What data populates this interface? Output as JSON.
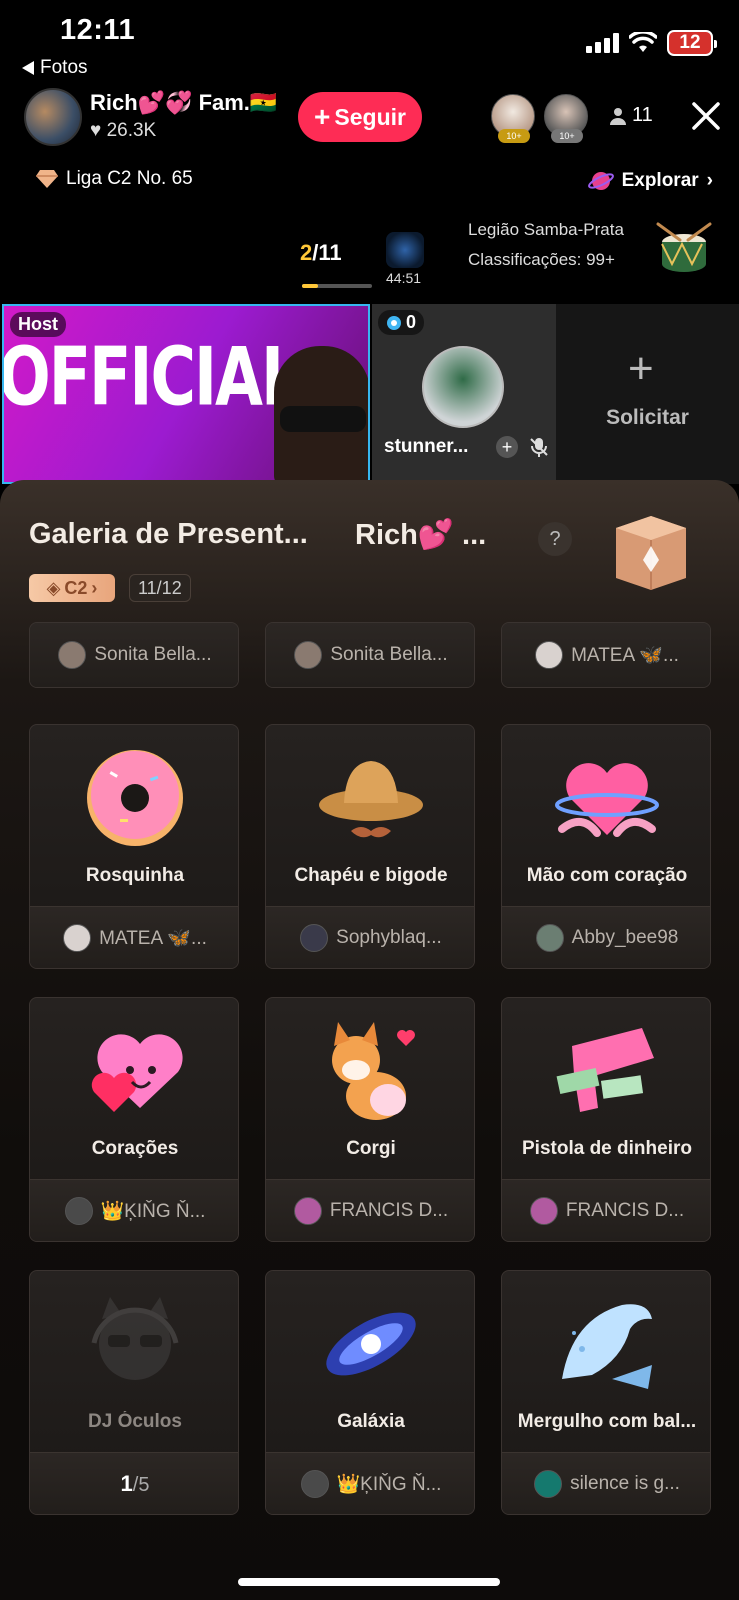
{
  "status": {
    "time": "12:11",
    "battery": "12",
    "back_label": "Fotos"
  },
  "header": {
    "host_name": "Rich💕💞 Fam.🇬🇭",
    "likes": "26.3K",
    "follow_label": "Seguir",
    "viewer_badges": [
      "10+",
      "10+"
    ],
    "viewer_count": "11"
  },
  "league": {
    "label": "Liga C2 No. 65",
    "explore_label": "Explorar"
  },
  "ranking": {
    "current": "2",
    "total": "/11",
    "timer": "44:51",
    "legion_title": "Legião Samba-Prata",
    "legion_rank": "Classificações: 99+"
  },
  "video": {
    "host_tag": "Host",
    "banner_text": "OFFICIAL",
    "guest_count": "0",
    "guest_name": "stunner...",
    "request_label": "Solicitar"
  },
  "gallery": {
    "title": "Galeria de Present...",
    "owner": "Rich💕 ...",
    "help": "?",
    "league_badge": "C2",
    "progress": "11/12",
    "partial_row": [
      {
        "who": "Sonita Bella..."
      },
      {
        "who": "Sonita Bella..."
      },
      {
        "who": "MATEA 🦋..."
      }
    ],
    "gifts": [
      {
        "name": "Rosquinha",
        "who": "MATEA 🦋..."
      },
      {
        "name": "Chapéu e bigode",
        "who": "Sophyblaq..."
      },
      {
        "name": "Mão com coração",
        "who": "Abby_bee98"
      },
      {
        "name": "Corações",
        "who": "👑ĶIŇG Ň..."
      },
      {
        "name": "Corgi",
        "who": "FRANCIS D..."
      },
      {
        "name": "Pistola de dinheiro",
        "who": "FRANCIS D..."
      },
      {
        "name": "DJ Óculos",
        "page_current": "1",
        "page_total": "/5"
      },
      {
        "name": "Galáxia",
        "who": "👑ĶIŇG Ň..."
      },
      {
        "name": "Mergulho com bal...",
        "who": "silence is g..."
      }
    ]
  },
  "colors": {
    "accent": "#fe2c55",
    "rank_gold": "#ffc738",
    "host_border": "#37b6ef"
  }
}
